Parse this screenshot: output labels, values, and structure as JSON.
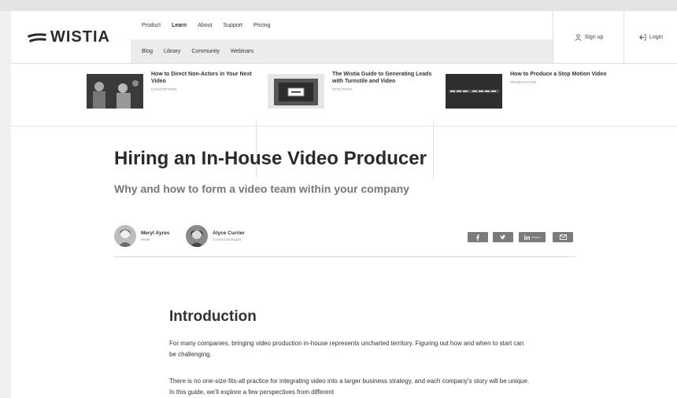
{
  "header": {
    "logo_text": "WISTIA",
    "nav_primary": [
      "Product",
      "Learn",
      "About",
      "Support",
      "Pricing"
    ],
    "nav_active": "Learn",
    "nav_secondary": [
      "Blog",
      "Library",
      "Community",
      "Webinars"
    ],
    "signup_label": "Sign up",
    "login_label": "Login"
  },
  "related": [
    {
      "title": "How to Direct Non-Actors in Your Next Video",
      "category": "CONCEPTING"
    },
    {
      "title": "The Wistia Guide to Generating Leads with Turnstile and Video",
      "category": "STRATEGY"
    },
    {
      "title": "How to Produce a Stop Motion Video",
      "category": "PRODUCTION"
    }
  ],
  "article": {
    "title": "Hiring an In-House Video Producer",
    "subtitle": "Why and how to form a video team within your company"
  },
  "authors": [
    {
      "name": "Meryl Ayres",
      "role": "Writer"
    },
    {
      "name": "Alyce Currier",
      "role": "Content Strategist"
    }
  ],
  "share_buttons": [
    {
      "icon": "facebook-icon"
    },
    {
      "icon": "twitter-icon"
    },
    {
      "icon": "linkedin-icon",
      "label": "Share"
    },
    {
      "icon": "email-icon"
    }
  ],
  "content": {
    "intro_heading": "Introduction",
    "paragraph1": "For many companies, bringing video production in-house represents uncharted territory. Figuring out how and when to start can be challenging.",
    "paragraph2": "There is no one-size-fits-all practice for integrating video into a larger business strategy, and each company's story will be unique. In this guide, we'll explore a few perspectives from different"
  }
}
